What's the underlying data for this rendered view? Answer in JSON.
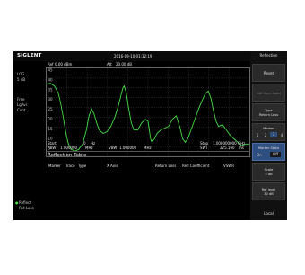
{
  "top": {
    "logo": "SIGLENT",
    "datetime": "2016-09-10  01:32:19",
    "title": "Reflection"
  },
  "plot_header": {
    "ref_label": "Ref",
    "ref_value": "0.00 dBm",
    "att_label": "Att",
    "att_value": "20.00 dB"
  },
  "left": {
    "mode": "LOG",
    "scale": "5  dB",
    "info1": "Free",
    "info2": "LgAvr",
    "info3": "Cont",
    "bottom1": "Reflect",
    "bottom2": "Ret Loss"
  },
  "y_ticks": [
    "45",
    "40",
    "35",
    "30",
    "25",
    "20",
    "15",
    "10",
    "5",
    "0"
  ],
  "freq": {
    "start_label": "Start",
    "start_value": "0",
    "start_unit": "Hz",
    "rbw_label": "RBW",
    "rbw_value": "1.000000",
    "rbw_unit": "MHz",
    "vbw_label": "VBW",
    "vbw_value": "1.000000",
    "vbw_unit": "MHz",
    "stop_label": "Stop",
    "stop_value": "1.000000000",
    "stop_unit": "GHz",
    "swt_label": "SWT",
    "swt_value": "225.160",
    "swt_unit": "ms"
  },
  "table": {
    "title": "Reflection Table",
    "columns": [
      "Marker",
      "Trace",
      "Type",
      "X Axis",
      "Return Loss",
      "Refl Coefficient",
      "VSWR"
    ]
  },
  "right": {
    "reset": "Reset",
    "cal_open_load": "Cal Open Load",
    "type_label": "Type",
    "type_value": "Return Loss",
    "marker_label": "Marker",
    "marker_options": [
      "1",
      "2",
      "3",
      "4"
    ],
    "marker_state_label": "Marker State",
    "on": "On",
    "off": "Off",
    "scale_label": "Scale",
    "scale_value": "5 dB",
    "ref_level_label": "Ref level",
    "ref_level_value": "30 dB",
    "local": "Local"
  },
  "colors": {
    "trace": "#44dd44",
    "highlight": "#2f4f80",
    "background": "#000000"
  }
}
